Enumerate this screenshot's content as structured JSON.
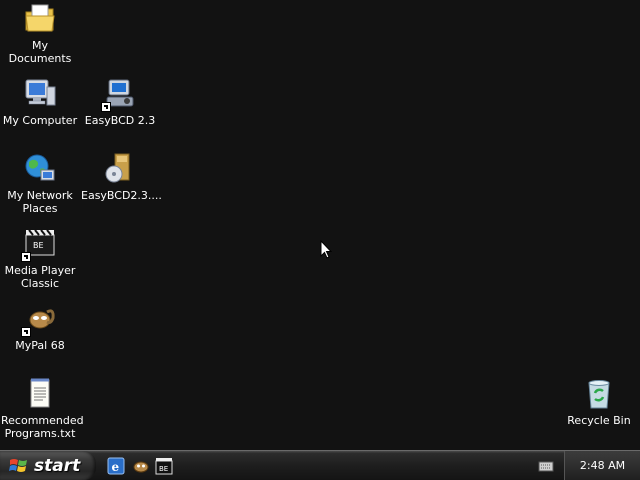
{
  "desktop": {
    "icons": [
      {
        "label": "My Documents",
        "icon": "my-documents-icon"
      },
      {
        "label": "My Computer",
        "icon": "my-computer-icon"
      },
      {
        "label": "EasyBCD 2.3",
        "icon": "easybcd-icon"
      },
      {
        "label": "My Network\nPlaces",
        "icon": "my-network-places-icon"
      },
      {
        "label": "EasyBCD2.3....",
        "icon": "easybcd-installer-icon"
      },
      {
        "label": "Media Player\nClassic",
        "icon": "media-player-classic-icon"
      },
      {
        "label": "MyPal 68",
        "icon": "mypal-icon"
      },
      {
        "label": "Recommended\nPrograms.txt",
        "icon": "text-file-icon"
      },
      {
        "label": "Recycle Bin",
        "icon": "recycle-bin-icon"
      }
    ]
  },
  "taskbar": {
    "start_label": "start",
    "quick_launch": [
      "internet-explorer-icon",
      "mypal-icon",
      "media-player-classic-icon"
    ],
    "clock": "2:48 AM"
  }
}
